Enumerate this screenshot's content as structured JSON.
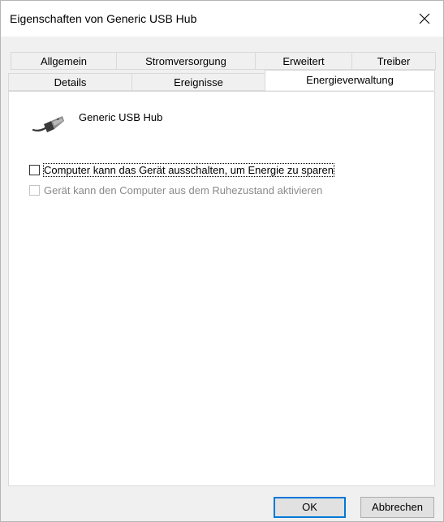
{
  "window": {
    "title": "Eigenschaften von Generic USB Hub"
  },
  "tabs": {
    "row1": [
      "Allgemein",
      "Stromversorgung",
      "Erweitert",
      "Treiber"
    ],
    "row2": [
      "Details",
      "Ereignisse",
      "Energieverwaltung"
    ],
    "active": "Energieverwaltung"
  },
  "panel": {
    "device_icon": "usb-connector-icon",
    "device_name": "Generic USB Hub",
    "option1": {
      "label": "Computer kann das Gerät ausschalten, um Energie zu sparen",
      "checked": false,
      "enabled": true
    },
    "option2": {
      "label": "Gerät kann den Computer aus dem Ruhezustand aktivieren",
      "checked": false,
      "enabled": false
    }
  },
  "buttons": {
    "ok": "OK",
    "cancel": "Abbrechen"
  },
  "colors": {
    "accent": "#0078d7",
    "window_bg": "#f0f0f0",
    "panel_bg": "#ffffff"
  }
}
